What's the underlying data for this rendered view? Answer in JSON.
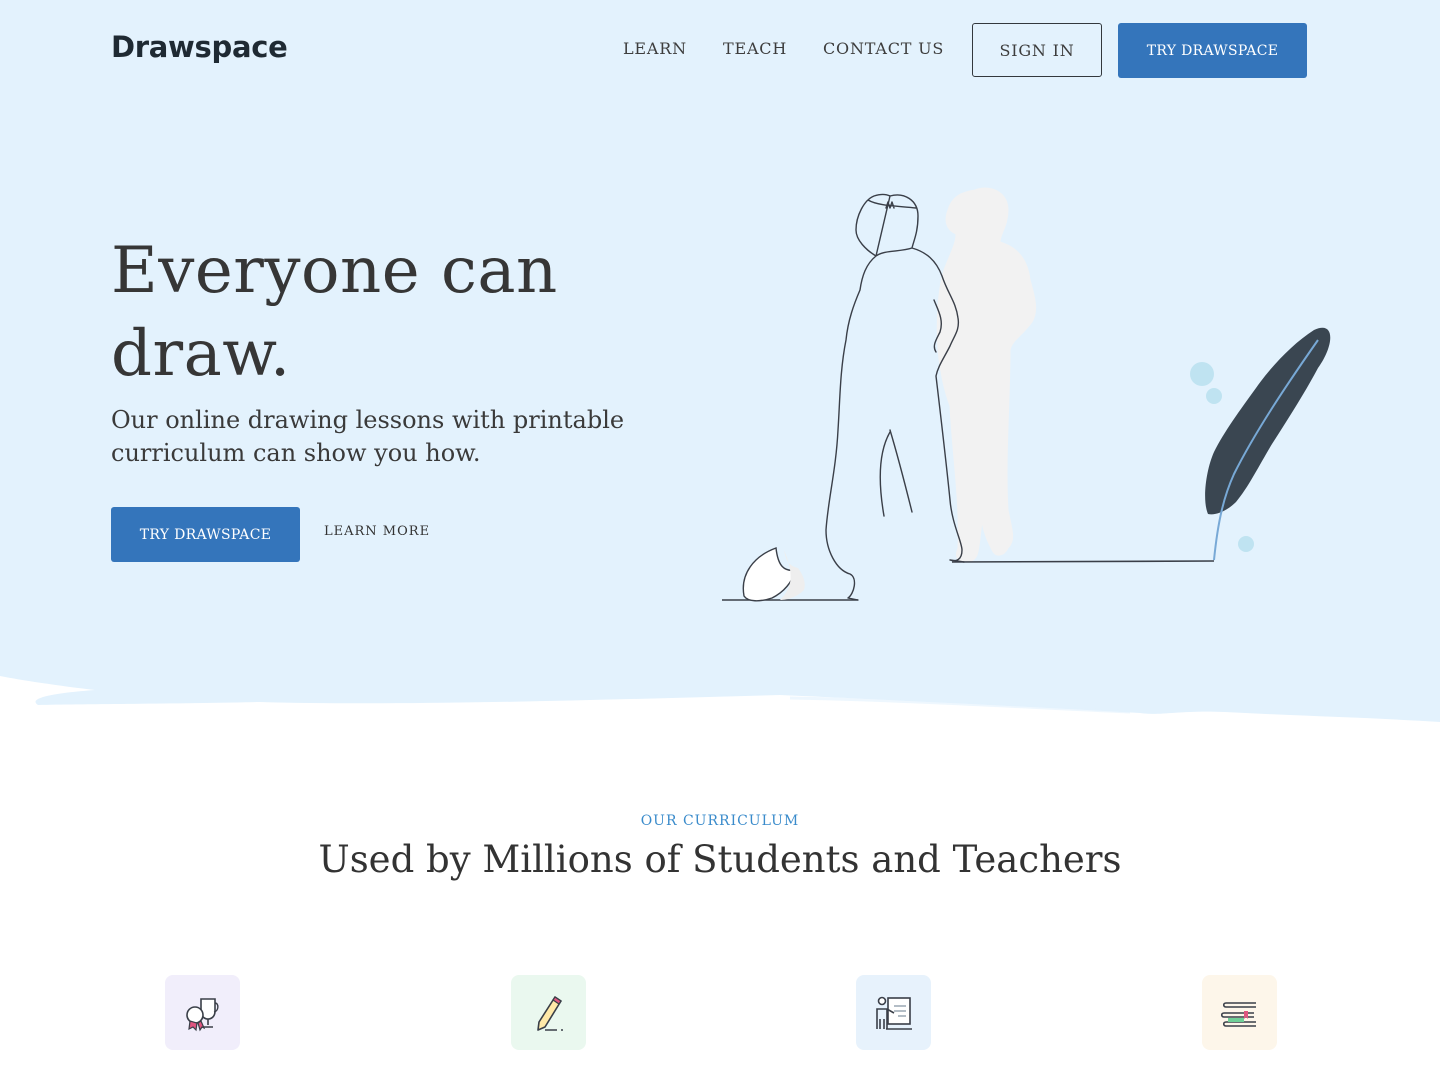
{
  "brand": {
    "name": "Drawspace"
  },
  "nav": {
    "links": [
      {
        "label": "LEARN"
      },
      {
        "label": "TEACH"
      },
      {
        "label": "CONTACT US"
      }
    ],
    "sign_in_label": "SIGN IN",
    "try_label": "TRY DRAWSPACE"
  },
  "hero": {
    "headline": "Everyone can draw.",
    "subheadline": "Our online drawing lessons with printable curriculum can show you how.",
    "primary_cta": "TRY DRAWSPACE",
    "secondary_cta": "LEARN MORE",
    "illustration": "woman-leaning-on-feather-quill-drawing"
  },
  "curriculum": {
    "eyebrow": "OUR CURRICULUM",
    "title": "Used by Millions of Students and Teachers",
    "features": [
      {
        "icon": "trophy-award-icon",
        "tile_color": "#f1eefb"
      },
      {
        "icon": "pencil-drawing-icon",
        "tile_color": "#eaf8ef"
      },
      {
        "icon": "teacher-presentation-icon",
        "tile_color": "#e7f2fc"
      },
      {
        "icon": "books-stack-icon",
        "tile_color": "#fdf6ea"
      }
    ]
  },
  "colors": {
    "hero_background": "#e3f2fd",
    "primary_button": "#3475bb",
    "eyebrow_accent": "#3a8bcb",
    "heading_text": "#363636"
  }
}
